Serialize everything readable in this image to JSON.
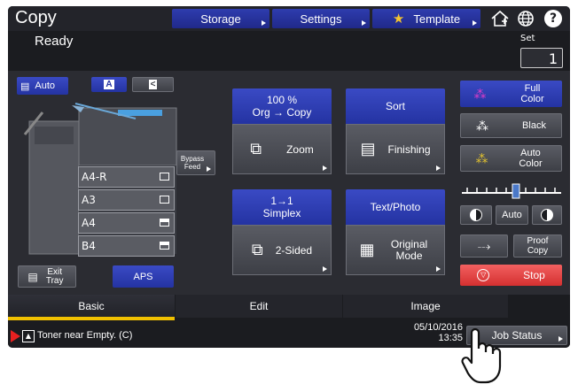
{
  "app": {
    "title": "Copy",
    "status": "Ready"
  },
  "topbar": {
    "storage": "Storage",
    "settings": "Settings",
    "template": "Template"
  },
  "set": {
    "label": "Set",
    "value": "1"
  },
  "left": {
    "auto_label": "Auto",
    "bypass_label": "Bypass Feed",
    "trays": [
      "A4-R",
      "A3",
      "A4",
      "B4"
    ],
    "exit_tray_label": "Exit Tray",
    "aps_label": "APS"
  },
  "center": {
    "zoom_header_line1": "100 %",
    "zoom_header_line2": "Org  →  Copy",
    "zoom_label": "Zoom",
    "sort_header": "Sort",
    "finishing_label": "Finishing",
    "duplex_header_line1": "1→1",
    "duplex_header_line2": "Simplex",
    "two_sided_label": "2-Sided",
    "textphoto_header": "Text/Photo",
    "original_mode_label": "Original Mode"
  },
  "right": {
    "full_color": "Full Color",
    "black": "Black",
    "auto_color": "Auto Color",
    "density_auto": "Auto",
    "proof_copy": "Proof Copy",
    "stop": "Stop"
  },
  "tabs": [
    "Basic",
    "Edit",
    "Image"
  ],
  "statusbar": {
    "message": "Toner near Empty. (C)",
    "date": "05/10/2016",
    "time": "13:35",
    "job_status": "Job Status"
  }
}
